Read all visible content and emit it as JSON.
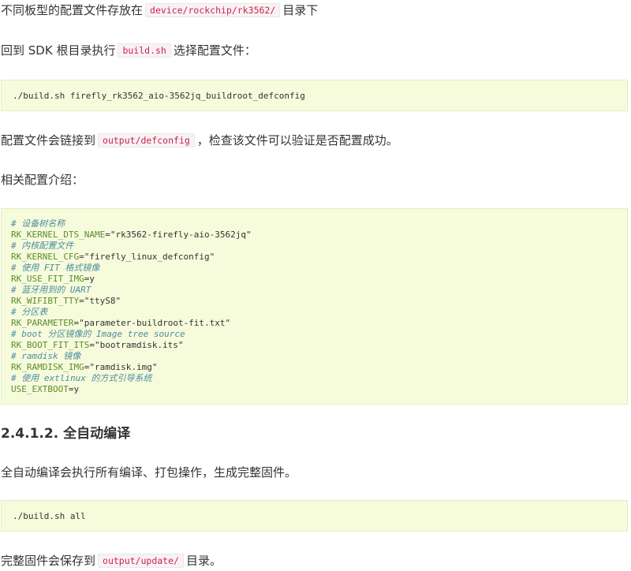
{
  "para1": {
    "before": "不同板型的配置文件存放在",
    "code": "device/rockchip/rk3562/",
    "after": "目录下"
  },
  "para2": {
    "before": "回到 SDK 根目录执行",
    "code": "build.sh",
    "after": "选择配置文件："
  },
  "code1": "./build.sh firefly_rk3562_aio-3562jq_buildroot_defconfig",
  "para3": {
    "before": "配置文件会链接到",
    "code": "output/defconfig",
    "after": "，检查该文件可以验证是否配置成功。"
  },
  "para4": "相关配置介绍：",
  "config": {
    "c1": "# 设备树名称",
    "v1": {
      "name": "RK_KERNEL_DTS_NAME",
      "value": "\"rk3562-firefly-aio-3562jq\""
    },
    "c2": "# 内核配置文件",
    "v2": {
      "name": "RK_KERNEL_CFG",
      "value": "\"firefly_linux_defconfig\""
    },
    "c3": "# 使用 FIT 格式镜像",
    "v3": {
      "name": "RK_USE_FIT_IMG",
      "value": "y"
    },
    "c4": "# 蓝牙用到的 UART",
    "v4": {
      "name": "RK_WIFIBT_TTY",
      "value": "\"ttyS8\""
    },
    "c5": "# 分区表",
    "v5": {
      "name": "RK_PARAMETER",
      "value": "\"parameter-buildroot-fit.txt\""
    },
    "c6": "# boot 分区镜像的 Image tree source",
    "v6": {
      "name": "RK_BOOT_FIT_ITS",
      "value": "\"bootramdisk.its\""
    },
    "c7": "# ramdisk 镜像",
    "v7": {
      "name": "RK_RAMDISK_IMG",
      "value": "\"ramdisk.img\""
    },
    "c8": "# 使用 extlinux 的方式引导系统",
    "v8": {
      "name": "USE_EXTBOOT",
      "value": "y"
    }
  },
  "heading": "2.4.1.2. 全自动编译",
  "para5": "全自动编译会执行所有编译、打包操作，生成完整固件。",
  "code2": "./build.sh all",
  "para6": {
    "before": "完整固件会保存到",
    "code": "output/update/",
    "after": "目录。"
  }
}
